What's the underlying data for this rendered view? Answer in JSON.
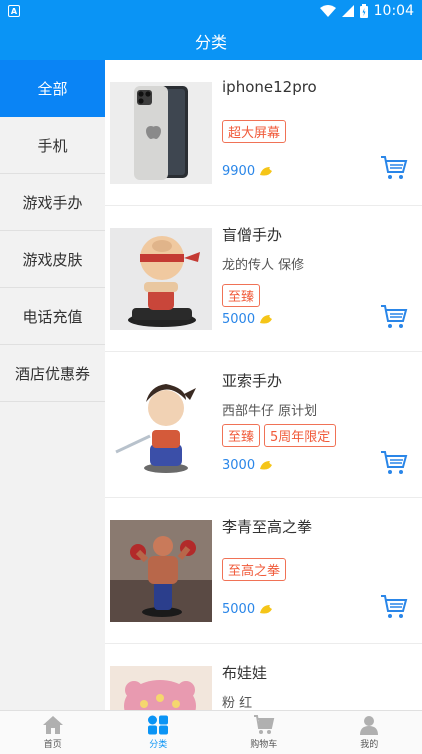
{
  "status": {
    "time": "10:04"
  },
  "title": "分类",
  "sidebar": {
    "items": [
      {
        "label": "全部"
      },
      {
        "label": "手机"
      },
      {
        "label": "游戏手办"
      },
      {
        "label": "游戏皮肤"
      },
      {
        "label": "电话充值"
      },
      {
        "label": "酒店优惠券"
      }
    ]
  },
  "products": [
    {
      "name": "iphone12pro",
      "subtitle": "",
      "tags": [
        "超大屏幕"
      ],
      "price": "9900"
    },
    {
      "name": "盲僧手办",
      "subtitle": "龙的传人 保修",
      "tags": [
        "至臻"
      ],
      "price": "5000"
    },
    {
      "name": "亚索手办",
      "subtitle": "西部牛仔 原计划",
      "tags": [
        "至臻",
        "5周年限定"
      ],
      "price": "3000"
    },
    {
      "name": "李青至高之拳",
      "subtitle": "",
      "tags": [
        "至高之拳"
      ],
      "price": "5000"
    },
    {
      "name": "布娃娃",
      "subtitle": "粉 红",
      "tags": [],
      "price": ""
    }
  ],
  "tabs": [
    {
      "label": "首页",
      "icon": "home-icon"
    },
    {
      "label": "分类",
      "icon": "category-icon"
    },
    {
      "label": "购物车",
      "icon": "cart-icon"
    },
    {
      "label": "我的",
      "icon": "user-icon"
    }
  ],
  "colors": {
    "primary": "#0a94f5",
    "tag": "#f05a3a",
    "price": "#2a86e8",
    "coin": "#f5c518"
  }
}
